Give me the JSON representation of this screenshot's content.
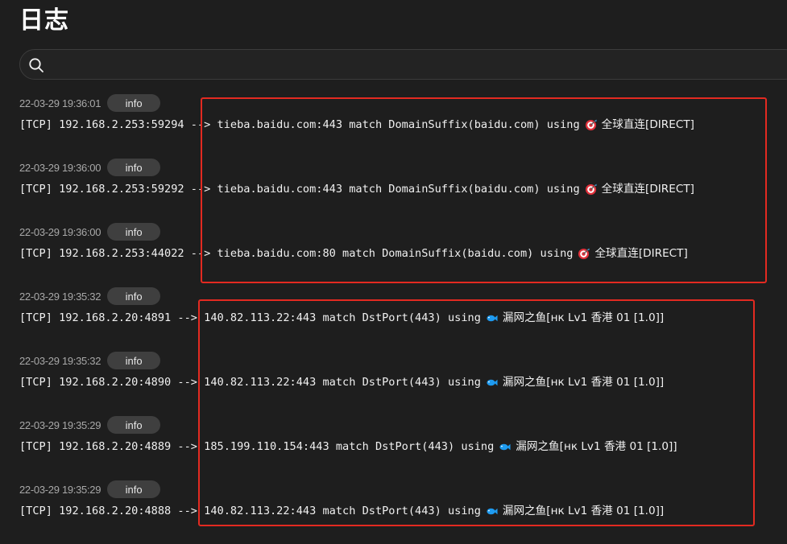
{
  "page": {
    "title": "日志"
  },
  "search": {
    "placeholder": "",
    "value": ""
  },
  "colors": {
    "background": "#1e1e1e",
    "badge_bg": "#3f3f3f",
    "highlight_border": "#e32a21",
    "fish_icon": "#1e9bf0",
    "target_icon": "#e0303a"
  },
  "logs": [
    {
      "time": "22-03-29 19:36:01",
      "level": "info",
      "prefix": "[TCP] 192.168.2.253:59294 --> tieba.baidu.com:443 match DomainSuffix(baidu.com) using",
      "icon": "target-icon",
      "group": "全球直连[DIRECT]"
    },
    {
      "time": "22-03-29 19:36:00",
      "level": "info",
      "prefix": "[TCP] 192.168.2.253:59292 --> tieba.baidu.com:443 match DomainSuffix(baidu.com) using",
      "icon": "target-icon",
      "group": "全球直连[DIRECT]"
    },
    {
      "time": "22-03-29 19:36:00",
      "level": "info",
      "prefix": "[TCP] 192.168.2.253:44022 --> tieba.baidu.com:80 match DomainSuffix(baidu.com) using",
      "icon": "target-icon",
      "group": "全球直连[DIRECT]"
    },
    {
      "time": "22-03-29 19:35:32",
      "level": "info",
      "prefix": "[TCP] 192.168.2.20:4891 --> 140.82.113.22:443 match DstPort(443) using",
      "icon": "fish-icon",
      "group": "漏网之鱼[нк Lv1 香港 01 [1.0]]"
    },
    {
      "time": "22-03-29 19:35:32",
      "level": "info",
      "prefix": "[TCP] 192.168.2.20:4890 --> 140.82.113.22:443 match DstPort(443) using",
      "icon": "fish-icon",
      "group": "漏网之鱼[нк Lv1 香港 01 [1.0]]"
    },
    {
      "time": "22-03-29 19:35:29",
      "level": "info",
      "prefix": "[TCP] 192.168.2.20:4889 --> 185.199.110.154:443 match DstPort(443) using",
      "icon": "fish-icon",
      "group": "漏网之鱼[нк Lv1 香港 01 [1.0]]"
    },
    {
      "time": "22-03-29 19:35:29",
      "level": "info",
      "prefix": "[TCP] 192.168.2.20:4888 --> 140.82.113.22:443 match DstPort(443) using",
      "icon": "fish-icon",
      "group": "漏网之鱼[нк Lv1 香港 01 [1.0]]"
    }
  ]
}
